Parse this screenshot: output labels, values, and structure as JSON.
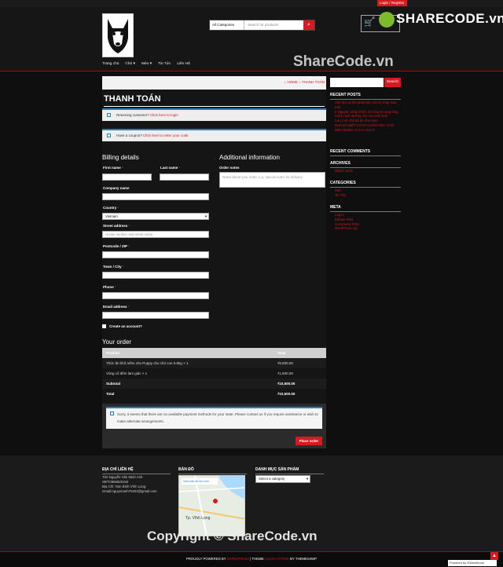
{
  "topbar": {
    "login_label": "Login / Register"
  },
  "header": {
    "search_category": "All Categories",
    "search_placeholder": "Search for products",
    "cart_count": "0",
    "sharecode_brand": "SHARECODE.vn",
    "watermark": "ShareCode.vn"
  },
  "nav": {
    "items": [
      "Trang chủ",
      "Chó ▾",
      "Mèo ▾",
      "Tin Tức",
      "Liên Hệ"
    ]
  },
  "breadcrumb": {
    "home": "HOME",
    "sep": "»",
    "current": "THANH TOÁN"
  },
  "page": {
    "title": "THANH TOÁN"
  },
  "notices": {
    "returning_text": "Returning customer?",
    "returning_link": "Click here to login",
    "coupon_text": "Have a coupon?",
    "coupon_link": "Click here to enter your code"
  },
  "billing": {
    "heading": "Billing details",
    "first_name": "First name",
    "last_name": "Last name",
    "company": "Company name",
    "country": "Country",
    "country_value": "Vietnam",
    "street": "Street address",
    "street_placeholder": "House number and street name",
    "postcode": "Postcode / ZIP",
    "town": "Town / City",
    "phone": "Phone",
    "email": "Email address",
    "create_account": "Create an account?"
  },
  "additional": {
    "heading": "Additional information",
    "notes_label": "Order notes",
    "notes_placeholder": "Notes about your order, e.g. special notes for delivery."
  },
  "order": {
    "heading": "Your order",
    "col_product": "Product",
    "col_total": "Total",
    "rows": [
      {
        "product": "Thức ăn khô mềm cho Puppy cho chó con 0.6kg  × 1",
        "total": "₫9,000.00"
      },
      {
        "product": "Vòng cổ đêm lam giác  × 1",
        "total": "₫1,500.00"
      }
    ],
    "subtotal_label": "Subtotal",
    "subtotal": "₫10,500.00",
    "total_label": "Total",
    "total": "₫10,500.00"
  },
  "payment": {
    "message": "Sorry, it seems that there are no available payment methods for your state. Please contact us if you require assistance or wish to make alternate arrangements.",
    "place_order": "Place order"
  },
  "sidebar": {
    "search_button": "Search",
    "recent_posts_title": "RECENT POSTS",
    "recent_posts": [
      "Cần làm gì khi phát hiện chó bị chảy máu mũi",
      "6 Nguyên nhân khiến chó hay bị rụng lông",
      "Cách nuôi dưỡng chó con mới sinh",
      "Lưu ý về chế độ ăn cho mèo",
      "BẠN ĐÃ BIẾT CÁCH CHĂM SÓC CHÓ MÈO ĐÚNG CÁCH CHƯA"
    ],
    "recent_comments_title": "RECENT COMMENTS",
    "archives_title": "ARCHIVES",
    "archives": [
      "March 2019"
    ],
    "categories_title": "CATEGORIES",
    "categories": [
      "Ảnh",
      "Tin Tức"
    ],
    "meta_title": "META",
    "meta": [
      "Log in",
      "Entries RSS",
      "Comments RSS",
      "WordPress.org"
    ]
  },
  "footer": {
    "contact_title": "ĐỊA CHỈ LIÊN HỆ",
    "contact_lines": [
      "Tên:Nguyễn Văn Minh Anh",
      "SĐT:0966825150",
      "Địa Chỉ: Tam Bình Vĩnh Long",
      "Gmail:nguyenanh79403@gmail.com"
    ],
    "map_title": "BẢN ĐỒ",
    "map_place": "Tp. Vĩnh Long",
    "map_search": "Xem bản đồ lớn hơn",
    "category_title": "DANH MỤC SẢN PHẨM",
    "category_select": "Select a category",
    "copyright_watermark": "Copyright © ShareCode.vn"
  },
  "credits": {
    "p1": "PROUDLY POWERED BY",
    "wp": "WORDPRESS",
    "p2": "| THEME:",
    "theme": "ALOHA STORE",
    "p3": "BY THEMES4WP"
  },
  "poweredby": "Powered by 000webhost",
  "colors": {
    "accent": "#d71920",
    "info": "#1e85be",
    "background": "#0f0f0f"
  }
}
